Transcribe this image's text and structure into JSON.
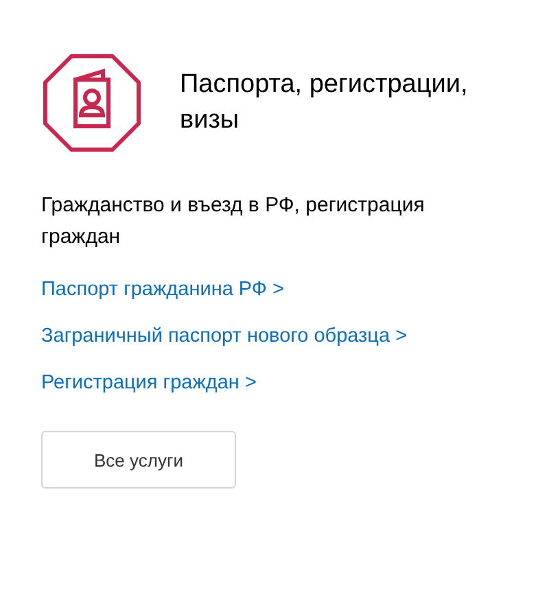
{
  "title": "Паспорта, регистрации, визы",
  "description": "Гражданство и въезд в РФ, регистрация граждан",
  "links": [
    {
      "label": "Паспорт гражданина РФ >"
    },
    {
      "label": "Заграничный паспорт нового образца >"
    },
    {
      "label": "Регистрация граждан >"
    }
  ],
  "button": "Все услуги"
}
